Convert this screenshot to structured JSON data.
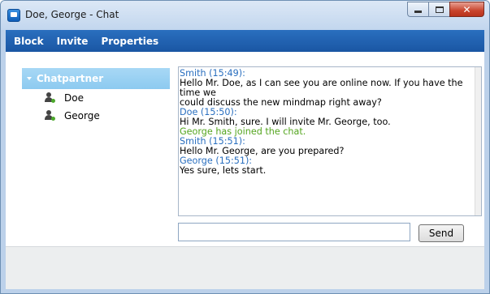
{
  "window": {
    "title": "Doe, George - Chat"
  },
  "menu": [
    {
      "label": "Block"
    },
    {
      "label": "Invite"
    },
    {
      "label": "Properties"
    }
  ],
  "partners": {
    "title": "Chatpartner",
    "items": [
      {
        "name": "Doe"
      },
      {
        "name": "George"
      }
    ]
  },
  "chat": [
    {
      "type": "head",
      "text": "Smith (15:49):"
    },
    {
      "type": "msg",
      "text": "Hello Mr. Doe, as I can see you are online now. If you have the time we"
    },
    {
      "type": "msg",
      "text": "could discuss the new mindmap right away?"
    },
    {
      "type": "head",
      "text": "Doe (15:50):"
    },
    {
      "type": "msg",
      "text": "Hi Mr. Smith, sure. I will invite Mr. George, too."
    },
    {
      "type": "sys",
      "text": "George has joined the chat."
    },
    {
      "type": "head",
      "text": "Smith (15:51):"
    },
    {
      "type": "msg",
      "text": "Hello Mr. George, are you prepared?"
    },
    {
      "type": "head",
      "text": "George (15:51):"
    },
    {
      "type": "msg",
      "text": "Yes sure, lets start."
    }
  ],
  "input": {
    "value": "",
    "placeholder": ""
  },
  "send": {
    "label": "Send"
  },
  "colors": {
    "menubar": "#1f5fae",
    "accent": "#2a6fbf",
    "system": "#54a51f",
    "partnerHeader": "#9ad0f3"
  }
}
